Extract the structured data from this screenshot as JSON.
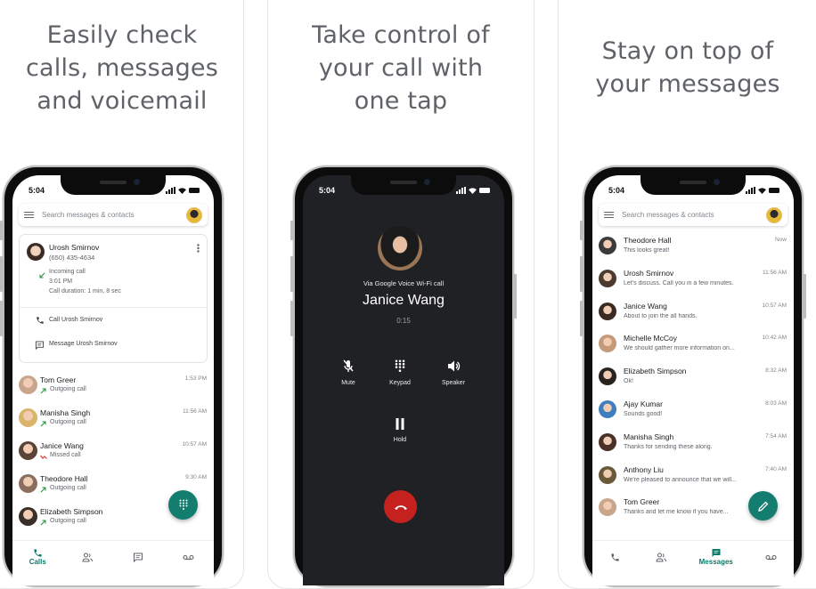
{
  "panels": [
    {
      "headline": [
        "Easily check",
        "calls, messages",
        "and voicemail"
      ],
      "phone": {
        "status_time": "5:04",
        "search_placeholder": "Search messages & contacts",
        "detail_card": {
          "name": "Urosh Smirnov",
          "phone": "(650) 435-4634",
          "call_type": "Incoming call",
          "call_time": "3:01 PM",
          "duration": "Call duration: 1 min, 8 sec",
          "actions": [
            "Call Urosh Smirnov",
            "Message Urosh Smirnov"
          ]
        },
        "calls": [
          {
            "name": "Tom Greer",
            "type": "Outgoing call",
            "time": "1:53 PM",
            "status": "outgoing"
          },
          {
            "name": "Manisha Singh",
            "type": "Outgoing call",
            "time": "11:56 AM",
            "status": "outgoing"
          },
          {
            "name": "Janice Wang",
            "type": "Missed call",
            "time": "10:57 AM",
            "status": "missed"
          },
          {
            "name": "Theodore Hall",
            "type": "Outgoing call",
            "time": "9:30 AM",
            "status": "outgoing"
          },
          {
            "name": "Elizabeth Simpson",
            "type": "Outgoing call",
            "time": "",
            "status": "outgoing"
          }
        ],
        "nav": [
          {
            "label": "Calls",
            "icon": "phone-icon",
            "active": true
          },
          {
            "label": "",
            "icon": "contacts-icon",
            "active": false
          },
          {
            "label": "",
            "icon": "messages-icon",
            "active": false
          },
          {
            "label": "",
            "icon": "voicemail-icon",
            "active": false
          }
        ],
        "fab_icon": "dialpad-icon"
      }
    },
    {
      "headline": [
        "Take control of",
        "your call with",
        "one tap"
      ],
      "phone": {
        "status_time": "5:04",
        "via": "Via Google Voice Wi-Fi call",
        "caller": "Janice Wang",
        "elapsed": "0:15",
        "controls": [
          {
            "label": "Mute",
            "icon": "mic-off-icon"
          },
          {
            "label": "Keypad",
            "icon": "dialpad-icon"
          },
          {
            "label": "Speaker",
            "icon": "speaker-icon"
          },
          {
            "label": "Hold",
            "icon": "pause-icon"
          }
        ],
        "end_call_icon": "end-call-icon"
      }
    },
    {
      "headline": [
        "Stay on top of",
        "your messages"
      ],
      "phone": {
        "status_time": "5:04",
        "search_placeholder": "Search messages & contacts",
        "messages": [
          {
            "name": "Theodore Hall",
            "preview": "This looks great!",
            "time": "Now"
          },
          {
            "name": "Urosh Smirnov",
            "preview": "Let's discuss. Call you in a few minutes.",
            "time": "11:56 AM"
          },
          {
            "name": "Janice Wang",
            "preview": "About to join the all hands.",
            "time": "10:57 AM"
          },
          {
            "name": "Michelle McCoy",
            "preview": "We should gather more information on...",
            "time": "10:42 AM"
          },
          {
            "name": "Elizabeth Simpson",
            "preview": "Ok!",
            "time": "8:32 AM"
          },
          {
            "name": "Ajay Kumar",
            "preview": "Sounds good!",
            "time": "8:03 AM"
          },
          {
            "name": "Manisha Singh",
            "preview": "Thanks for sending these along.",
            "time": "7:54 AM"
          },
          {
            "name": "Anthony Liu",
            "preview": "We're pleased to announce that we will...",
            "time": "7:40 AM"
          },
          {
            "name": "Tom Greer",
            "preview": "Thanks and let me know if you have...",
            "time": ""
          }
        ],
        "nav": [
          {
            "label": "",
            "icon": "phone-icon",
            "active": false
          },
          {
            "label": "",
            "icon": "contacts-icon",
            "active": false
          },
          {
            "label": "Messages",
            "icon": "messages-icon",
            "active": true
          },
          {
            "label": "",
            "icon": "voicemail-icon",
            "active": false
          }
        ],
        "fab_icon": "pencil-icon"
      }
    }
  ],
  "colors": {
    "accent": "#137d6f",
    "missed": "#d93025",
    "end_call": "#c5221f",
    "dark_bg": "#202124",
    "headline": "#5f6368"
  }
}
